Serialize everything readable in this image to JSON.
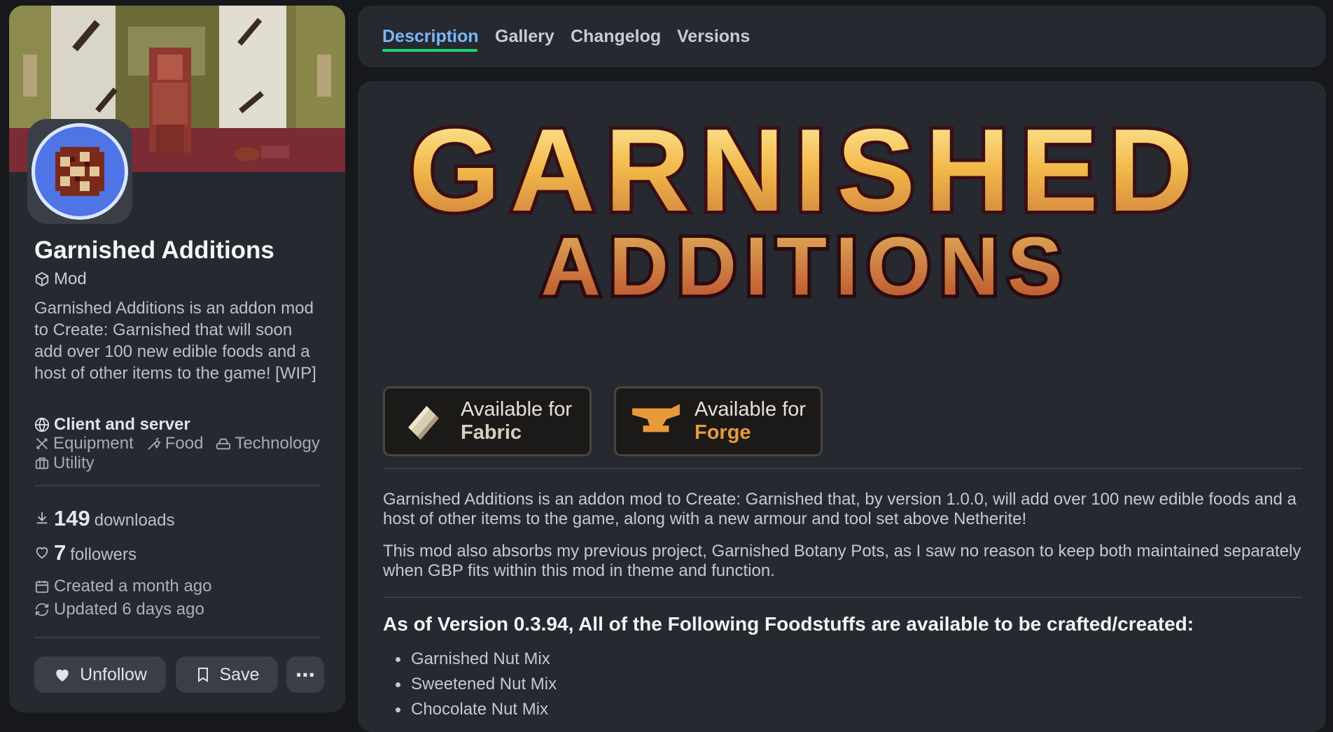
{
  "project": {
    "title": "Garnished Additions",
    "type": "Mod",
    "summary": "Garnished Additions is an addon mod to Create: Garnished that will soon add over 100 new edible foods and a host of other items to the game! [WIP]",
    "environment": "Client and server",
    "tags": [
      {
        "label": "Equipment",
        "icon": "swords-icon"
      },
      {
        "label": "Food",
        "icon": "carrot-icon"
      },
      {
        "label": "Technology",
        "icon": "hard-drive-icon"
      },
      {
        "label": "Utility",
        "icon": "briefcase-icon"
      }
    ],
    "downloads_count": "149",
    "downloads_label": "downloads",
    "followers_count": "7",
    "followers_label": "followers",
    "created": "Created a month ago",
    "updated": "Updated 6 days ago"
  },
  "actions": {
    "unfollow": "Unfollow",
    "save": "Save",
    "more": "⋯"
  },
  "tabs": [
    "Description",
    "Gallery",
    "Changelog",
    "Versions"
  ],
  "active_tab": "Description",
  "logo": {
    "line1": "GARNISHED",
    "line2": "ADDITIONS"
  },
  "loaders": [
    {
      "line1": "Available for",
      "line2": "Fabric"
    },
    {
      "line1": "Available for",
      "line2": "Forge"
    }
  ],
  "description": {
    "p1": "Garnished Additions is an addon mod to Create: Garnished that, by version 1.0.0, will add over 100 new edible foods and a host of other items to the game, along with a new armour and tool set above Netherite!",
    "p2": "This mod also absorbs my previous project, Garnished Botany Pots, as I saw no reason to keep both maintained separately when GBP fits within this mod in theme and function.",
    "heading": "As of Version 0.3.94, All of the Following Foodstuffs are available to be crafted/created:",
    "items": [
      "Garnished Nut Mix",
      "Sweetened Nut Mix",
      "Chocolate Nut Mix"
    ]
  },
  "colors": {
    "accent_green": "#1bd96a",
    "card_bg": "#26292f",
    "page_bg": "#16181c",
    "forge_orange": "#e89a3a"
  }
}
